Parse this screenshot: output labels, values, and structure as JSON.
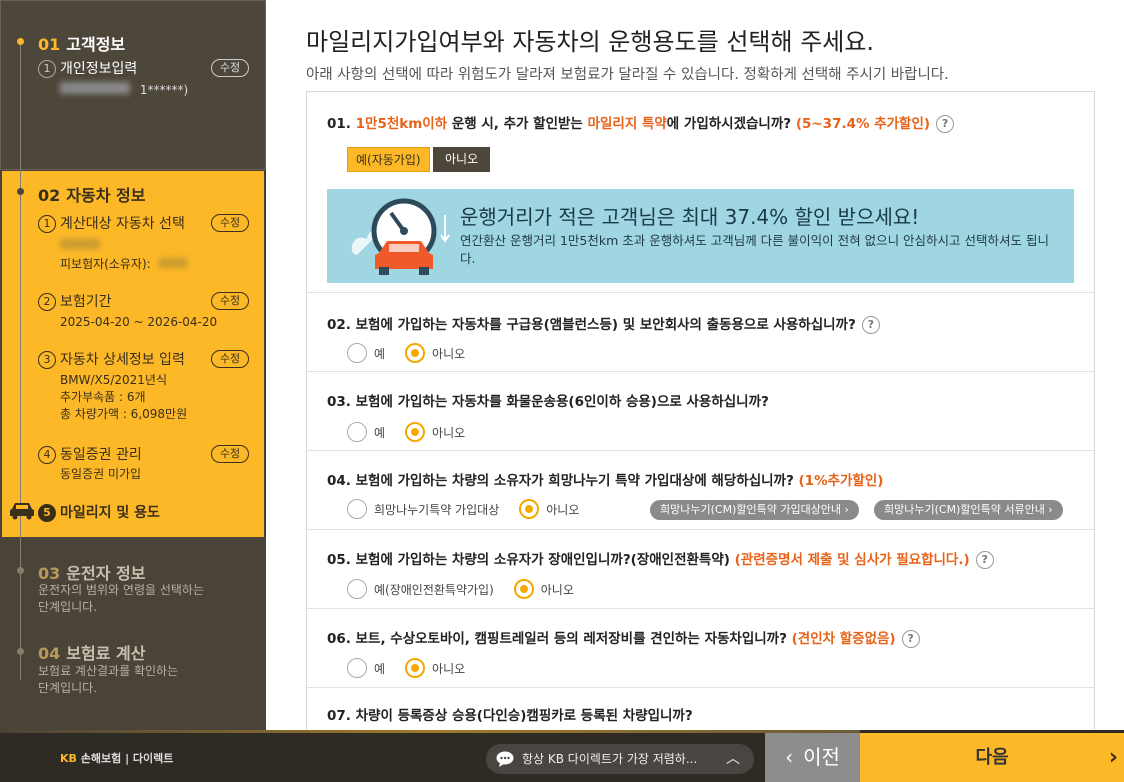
{
  "sidebar": {
    "s1": {
      "num": "01",
      "title": "고객정보",
      "item_num": "1",
      "item_label": "개인정보입력",
      "edit": "수정",
      "blurred_suffix": "1******)"
    },
    "s2": {
      "num": "02",
      "title": "자동차 정보",
      "items": [
        {
          "num": "1",
          "label": "계산대상 자동차 선택",
          "edit": "수정",
          "detail": "피보험자(소유자):"
        },
        {
          "num": "2",
          "label": "보험기간",
          "edit": "수정",
          "detail": "2025-04-20 ~ 2026-04-20"
        },
        {
          "num": "3",
          "label": "자동차 상세정보 입력",
          "edit": "수정",
          "d1": "BMW/X5/2021년식",
          "d2": "추가부속품 : 6개",
          "d3": "총 차량가액 : 6,098만원"
        },
        {
          "num": "4",
          "label": "동일증권 관리",
          "edit": "수정",
          "detail": "동일증권 미가입"
        },
        {
          "num": "5",
          "label": "마일리지 및 용도"
        }
      ]
    },
    "s3": {
      "num": "03",
      "title": "운전자 정보",
      "desc1": "운전자의 범위와 연령을 선택하는",
      "desc2": "단계입니다."
    },
    "s4": {
      "num": "04",
      "title": "보험료 계산",
      "desc1": "보험료 계산결과를 확인하는",
      "desc2": "단계입니다."
    }
  },
  "main": {
    "title": "마일리지가입여부와 자동차의 운행용도를 선택해 주세요.",
    "subtitle": "아래 사항의 선택에 따라 위험도가 달라져 보험료가 달라질 수 있습니다. 정확하게 선택해 주시기 바랍니다."
  },
  "q1": {
    "prefix": "01. ",
    "hl1": "1만5천km이하",
    "mid1": " 운행 시, 추가 할인받는 ",
    "hl2": "마일리지 특약",
    "mid2": "에 가입하시겠습니까? ",
    "hl3": "(5~37.4% 추가할인)",
    "yes": "예(자동가입)",
    "no": "아니오",
    "banner_title": "운행거리가 적은 고객님은 최대 37.4% 할인 받으세요!",
    "banner_body": "연간환산 운행거리 1만5천km 초과 운행하셔도 고객님께 다른 불이익이 전혀 없으니 안심하시고 선택하셔도 됩니다."
  },
  "q2": {
    "text": "02. 보험에 가입하는 자동차를 구급용(앰블런스등) 및 보안회사의 출동용으로 사용하십니까?",
    "opt1": "예",
    "opt2": "아니오"
  },
  "q3": {
    "text": "03. 보험에 가입하는 자동차를 화물운송용(6인이하 승용)으로 사용하십니까?",
    "opt1": "예",
    "opt2": "아니오"
  },
  "q4": {
    "text": "04. 보험에 가입하는 차량의 소유자가 희망나누기 특약 가입대상에 해당하십니까? ",
    "hl": "(1%추가할인)",
    "opt1": "희망나누기특약 가입대상",
    "opt2": "아니오",
    "pill1": "희망나누기(CM)할인특약 가입대상안내 ›",
    "pill2": "희망나누기(CM)할인특약 서류안내 ›"
  },
  "q5": {
    "text": "05. 보험에 가입하는 차량의 소유자가 장애인입니까?(장애인전환특약) ",
    "hl": "(관련증명서 제출 및 심사가 필요합니다.)",
    "opt1": "예(장애인전환특약가입)",
    "opt2": "아니오"
  },
  "q6": {
    "text": "06. 보트, 수상오토바이, 캠핑트레일러 등의 레저장비를 견인하는 자동차입니까? ",
    "hl": "(견인차 할증없음)",
    "opt1": "예",
    "opt2": "아니오"
  },
  "q7": {
    "text": "07. 차량이 등록증상 승용(다인승)캠핑카로 등록된 차량입니까?"
  },
  "footer": {
    "logo_kb": "KB",
    "logo_text": "손해보험  |  다이렉트",
    "chat": "항상 KB 다이렉트가 가장 저렴하...",
    "prev": "이전",
    "next": "다음"
  },
  "colors": {
    "accent": "#fdb827",
    "highlight": "#e8631a",
    "dark": "#4a4338"
  }
}
